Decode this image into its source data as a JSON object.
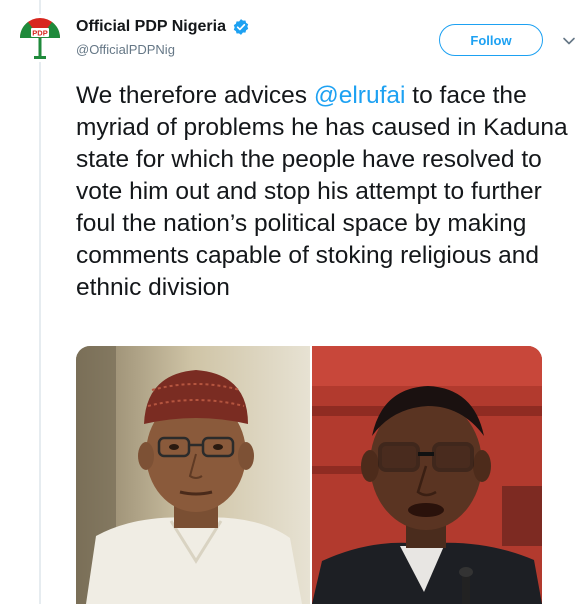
{
  "tweet": {
    "author": {
      "display_name": "Official PDP Nigeria",
      "handle": "@OfficialPDPNig",
      "verified": true,
      "avatar_logo_text": "PDP"
    },
    "follow_label": "Follow",
    "text_before_mention": "We therefore advices ",
    "mention": "@elrufai",
    "text_after_mention": " to face the myriad of problems he has caused in Kaduna state for which the people have resolved to vote him out and stop his attempt to further foul the nation’s political space by making comments capable of stoking religious and ethnic division",
    "media": {
      "photos": [
        "man-with-cap-portrait",
        "man-with-glasses-portrait"
      ]
    }
  },
  "colors": {
    "accent": "#1da1f2",
    "text": "#14171a",
    "muted": "#657786",
    "thread_line": "#e6ecf0"
  },
  "icons": {
    "verified": "verified-badge-icon",
    "caret": "chevron-down-icon"
  }
}
